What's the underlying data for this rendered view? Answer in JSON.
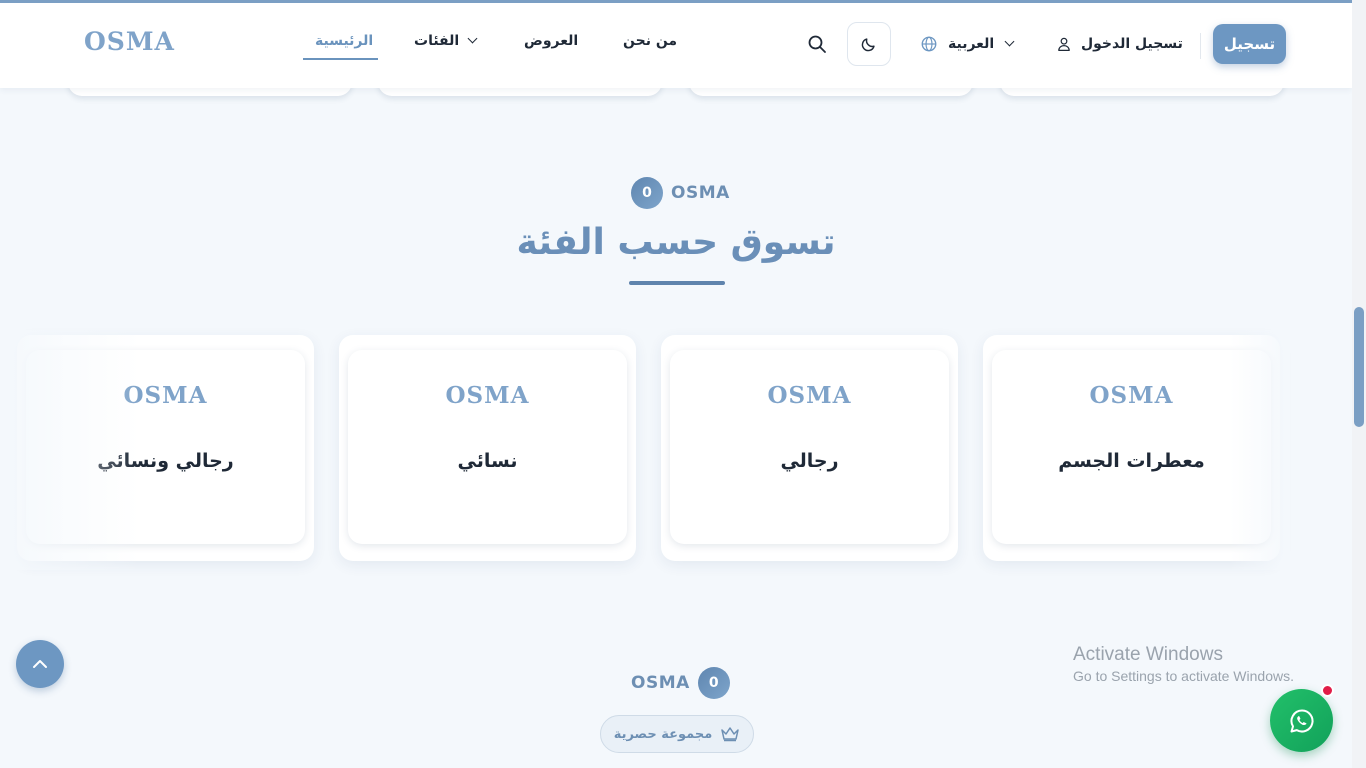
{
  "header": {
    "logo": "OSMA",
    "nav": [
      {
        "label": "الرئيسية",
        "active": true
      },
      {
        "label": "الفئات"
      },
      {
        "label": "العروض"
      },
      {
        "label": "من نحن"
      }
    ],
    "language": "العربية",
    "login": "تسجيل الدخول",
    "register": "تسجيل"
  },
  "section": {
    "badge_number": "0",
    "badge_text": "OSMA",
    "title": "تسوق حسب الفئة"
  },
  "categories": [
    {
      "logo": "OSMA",
      "name": "معطرات الجسم"
    },
    {
      "logo": "OSMA",
      "name": "رجالي"
    },
    {
      "logo": "OSMA",
      "name": "نسائي"
    },
    {
      "logo": "OSMA",
      "name": "رجالي ونسائي"
    }
  ],
  "section2": {
    "badge_number": "0",
    "badge_text": "OSMA",
    "pill_label": "مجموعة حصرية"
  },
  "windows_notice": {
    "title": "Activate Windows",
    "subtitle": "Go to Settings to activate Windows."
  },
  "icons": {
    "search": "search-icon",
    "theme": "moon-icon",
    "language": "globe-icon",
    "user": "user-icon",
    "scroll_top": "chevron-up-icon",
    "whatsapp": "whatsapp-icon",
    "crown": "crown-icon"
  },
  "colors": {
    "accent": "#6d97c2",
    "whatsapp": "#12a15a"
  }
}
